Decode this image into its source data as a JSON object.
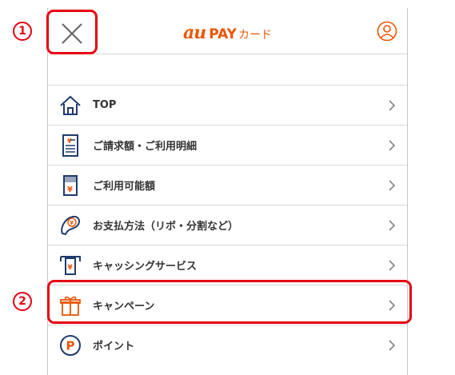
{
  "header": {
    "brand_au": "au",
    "brand_pay": "PAY",
    "brand_card": "カード"
  },
  "menu": {
    "items": [
      {
        "label": "TOP",
        "icon": "home-icon"
      },
      {
        "label": "ご請求額・ご利用明細",
        "icon": "statement-icon"
      },
      {
        "label": "ご利用可能額",
        "icon": "available-amount-icon"
      },
      {
        "label": "お支払方法（リボ・分割など）",
        "icon": "payment-method-icon"
      },
      {
        "label": "キャッシングサービス",
        "icon": "cashing-icon"
      },
      {
        "label": "キャンペーン",
        "icon": "gift-icon"
      },
      {
        "label": "ポイント",
        "icon": "points-icon"
      }
    ]
  },
  "annotations": {
    "marker_1": "1",
    "marker_2": "2"
  },
  "colors": {
    "brand": "#eb5505",
    "icon_blue": "#1f3a6e",
    "highlight": "#e60012"
  }
}
